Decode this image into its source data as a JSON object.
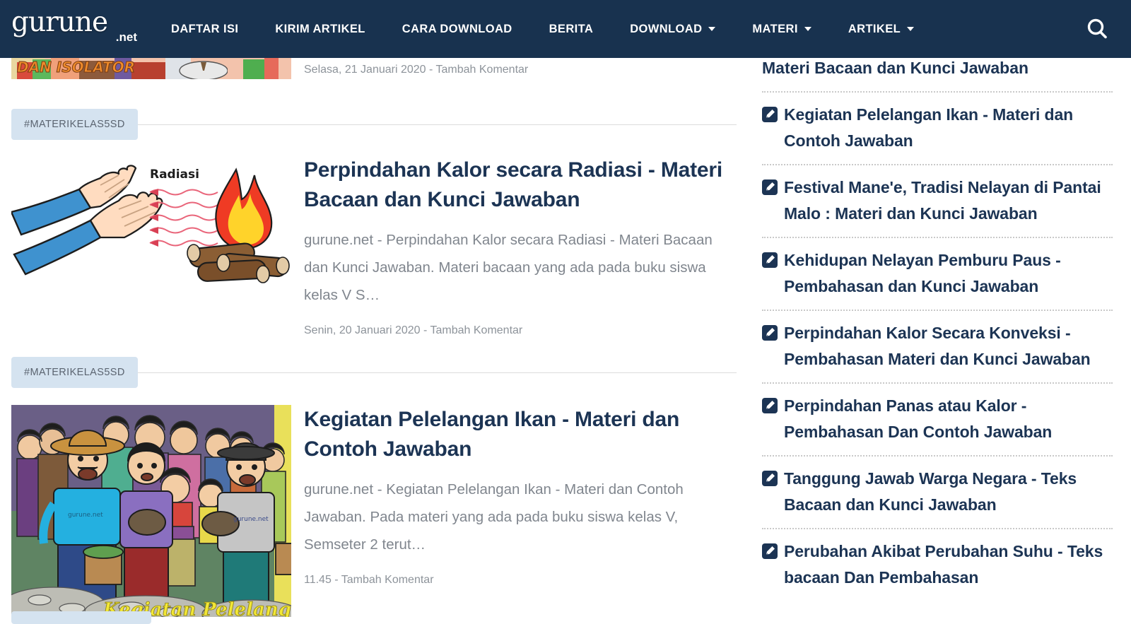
{
  "header": {
    "logo": {
      "main": "gurune",
      "sub": ".net"
    },
    "nav": [
      {
        "label": "DAFTAR ISI",
        "dropdown": false
      },
      {
        "label": "KIRIM ARTIKEL",
        "dropdown": false
      },
      {
        "label": "CARA DOWNLOAD",
        "dropdown": false
      },
      {
        "label": "BERITA",
        "dropdown": false
      },
      {
        "label": "DOWNLOAD",
        "dropdown": true
      },
      {
        "label": "MATERI",
        "dropdown": true
      },
      {
        "label": "ARTIKEL",
        "dropdown": true
      }
    ],
    "search_icon": "search-icon",
    "background_color": "#18324f",
    "text_color": "#ffffff"
  },
  "main": {
    "truncated_post": {
      "thumb_caption": "DAN ISOLATOR",
      "meta": "Selasa, 21 Januari 2020  -  Tambah Komentar"
    },
    "posts": [
      {
        "tag": "#MATERIKELAS5SD",
        "title": "Perpindahan Kalor secara Radiasi - Materi Bacaan dan Kunci Jawaban",
        "excerpt": "gurune.net - Perpindahan Kalor secara Radiasi - Materi Bacaan dan Kunci Jawaban. Materi bacaan yang ada pada buku siswa kelas V S…",
        "meta": "Senin, 20 Januari 2020  -  Tambah Komentar",
        "thumb_alt": "radiation-heat-illustration",
        "thumb_label": "Radiasi"
      },
      {
        "tag": "#MATERIKELAS5SD",
        "title": "Kegiatan Pelelangan Ikan - Materi dan Contoh Jawaban",
        "excerpt": "gurune.net - Kegiatan Pelelangan Ikan - Materi dan Contoh Jawaban. Pada materi yang ada pada buku siswa kelas V, Semseter 2 terut…",
        "meta": "11.45  -  Tambah Komentar",
        "thumb_alt": "fish-auction-crowd-illustration",
        "thumb_label": ""
      }
    ]
  },
  "sidebar": {
    "first_item_tail": "Materi Bacaan dan Kunci Jawaban",
    "items": [
      {
        "icon": "edit-pencil-icon",
        "label": "Kegiatan Pelelangan Ikan - Materi dan Contoh Jawaban"
      },
      {
        "icon": "edit-pencil-icon",
        "label": "Festival Mane'e, Tradisi Nelayan di Pantai Malo : Materi dan Kunci Jawaban"
      },
      {
        "icon": "edit-pencil-icon",
        "label": "Kehidupan Nelayan Pemburu Paus - Pembahasan dan Kunci Jawaban"
      },
      {
        "icon": "edit-pencil-icon",
        "label": "Perpindahan Kalor Secara Konveksi - Pembahasan Materi dan Kunci Jawaban"
      },
      {
        "icon": "edit-pencil-icon",
        "label": "Perpindahan Panas atau Kalor - Pembahasan Dan Contoh Jawaban"
      },
      {
        "icon": "edit-pencil-icon",
        "label": "Tanggung Jawab Warga Negara - Teks Bacaan dan Kunci Jawaban"
      },
      {
        "icon": "edit-pencil-icon",
        "label": "Perubahan Akibat Perubahan Suhu - Teks bacaan Dan Pembahasan"
      }
    ]
  },
  "colors": {
    "brand_navy": "#18324f",
    "title_navy": "#1c3454",
    "tag_badge_bg": "#d5e3f0",
    "muted_text": "#80868e"
  }
}
